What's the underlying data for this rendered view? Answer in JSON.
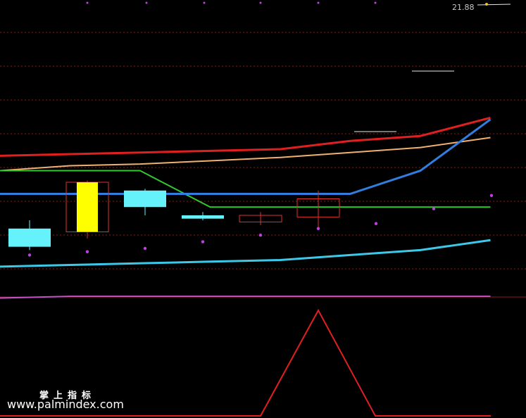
{
  "price_label": "21.88",
  "watermark": {
    "brand": "掌上指标",
    "url": "www.palmindex.com"
  },
  "colors": {
    "background": "#000000",
    "grid": "#8b1a1a",
    "up_candle": "#e03030",
    "down_candle": "#66f2fa",
    "yellow_candle": "#ffff00",
    "line_red": "#e02020",
    "line_orange": "#f0b070",
    "line_green": "#30c830",
    "line_blue": "#2f7ee0",
    "line_cyan": "#3cc8e8",
    "line_magenta": "#c850c8",
    "dots": "#c040e0",
    "indicator": "#e02020",
    "white_marks": "#e8e8e8"
  },
  "chart_data": [
    {
      "type": "candlestick",
      "title": "",
      "xlabel": "",
      "ylabel": "",
      "ylim": [
        0,
        100
      ],
      "grid": true,
      "candles": [
        {
          "index": 0,
          "open": 21,
          "close": 32,
          "high": 37,
          "low": 19,
          "style": "down"
        },
        {
          "index": 1,
          "open": 60,
          "close": 30,
          "high": 61,
          "low": 26,
          "style": "yellow"
        },
        {
          "index": 2,
          "open": 55,
          "close": 45,
          "high": 56,
          "low": 40,
          "style": "down"
        },
        {
          "index": 3,
          "open": 40,
          "close": 38,
          "high": 42,
          "low": 37,
          "style": "down"
        },
        {
          "index": 4,
          "open": 36,
          "close": 40,
          "high": 42,
          "low": 34,
          "style": "up"
        },
        {
          "index": 5,
          "open": 39,
          "close": 50,
          "high": 55,
          "low": 32,
          "style": "up"
        }
      ],
      "series": [
        {
          "key": "line_red",
          "values": [
            76,
            77,
            78,
            79,
            80,
            85,
            88,
            99
          ]
        },
        {
          "key": "line_orange",
          "values": [
            67,
            70,
            71,
            73,
            75,
            78,
            81,
            87
          ]
        },
        {
          "key": "line_green",
          "values": [
            67,
            67,
            67,
            45,
            45,
            45,
            45,
            45
          ]
        },
        {
          "key": "line_blue",
          "values": [
            53,
            53,
            53,
            53,
            53,
            53,
            67,
            98
          ]
        },
        {
          "key": "line_cyan",
          "values": [
            9,
            10,
            11,
            12,
            13,
            16,
            19,
            25
          ]
        },
        {
          "key": "line_magenta",
          "values": [
            -10,
            -9,
            -9,
            -9,
            -9,
            -9,
            -9,
            -9
          ]
        }
      ],
      "dots": [
        {
          "index": 0,
          "value": 16
        },
        {
          "index": 1,
          "value": 18
        },
        {
          "index": 2,
          "value": 20
        },
        {
          "index": 3,
          "value": 24
        },
        {
          "index": 4,
          "value": 28
        },
        {
          "index": 5,
          "value": 32
        },
        {
          "index": 6,
          "value": 35
        },
        {
          "index": 7,
          "value": 44
        },
        {
          "index": 8,
          "value": 52
        }
      ]
    },
    {
      "type": "line",
      "title": "",
      "xlabel": "",
      "ylabel": "",
      "ylim": [
        0,
        1
      ],
      "series": [
        {
          "key": "indicator",
          "values": [
            0,
            0,
            0,
            0,
            0,
            1,
            0,
            0,
            0
          ]
        }
      ]
    }
  ]
}
